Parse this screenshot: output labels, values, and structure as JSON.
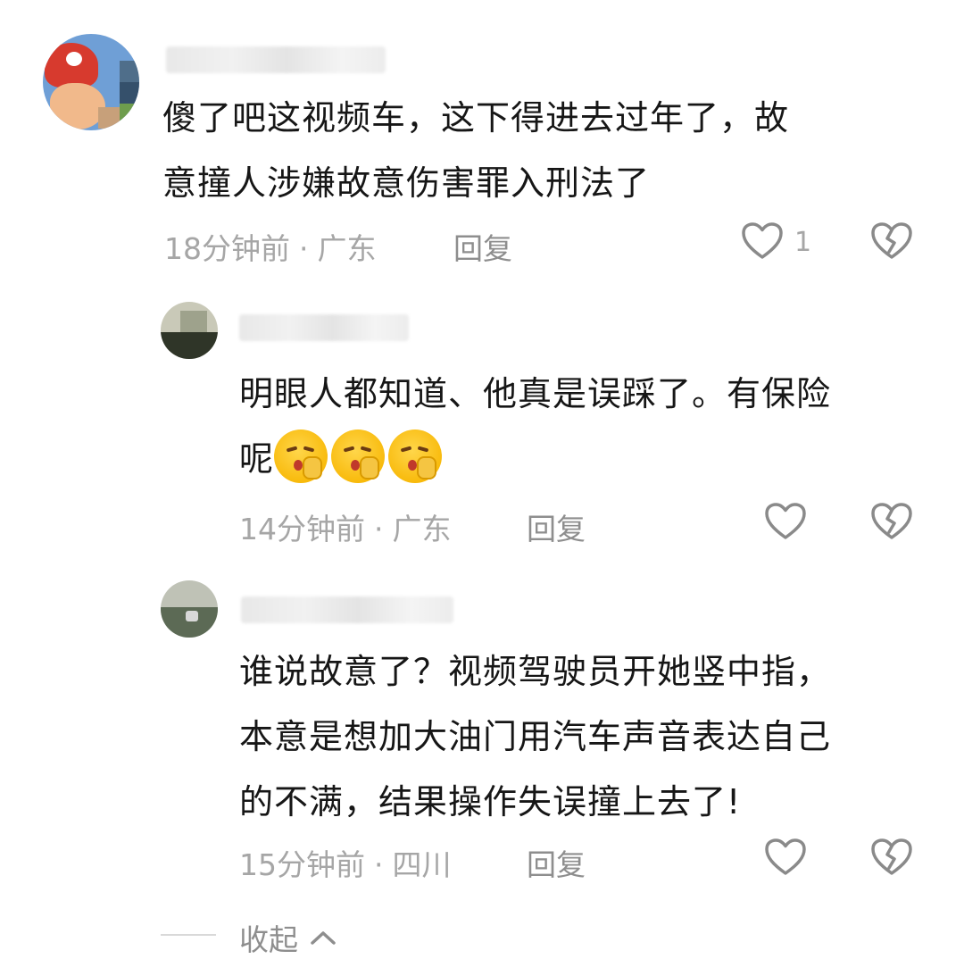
{
  "comments": [
    {
      "text_line1": "傻了吧这视频车，这下得进去过年了，故",
      "text_line2": "意撞人涉嫌故意伤害罪入刑法了",
      "time": "18分钟前",
      "location": "广东",
      "reply_label": "回复",
      "like_count": "1",
      "separator": "·"
    }
  ],
  "replies": [
    {
      "text_line1": "明眼人都知道、他真是误踩了。有保险",
      "text_line2": "呢",
      "emoji": "shushing-face",
      "emoji_count": 3,
      "time": "14分钟前",
      "location": "广东",
      "reply_label": "回复",
      "separator": "·"
    },
    {
      "text_line1": "谁说故意了？视频驾驶员开她竖中指，",
      "text_line2": "本意是想加大油门用汽车声音表达自己",
      "text_line3": "的不满，结果操作失误撞上去了!",
      "time": "15分钟前",
      "location": "四川",
      "reply_label": "回复",
      "separator": "·"
    }
  ],
  "collapse_label": "收起",
  "icons": {
    "like": "heart-outline-icon",
    "dislike": "broken-heart-icon",
    "collapse": "chevron-up-icon"
  },
  "colors": {
    "text": "#161616",
    "meta": "#a6a6a6",
    "icon": "#8a8a8a"
  }
}
